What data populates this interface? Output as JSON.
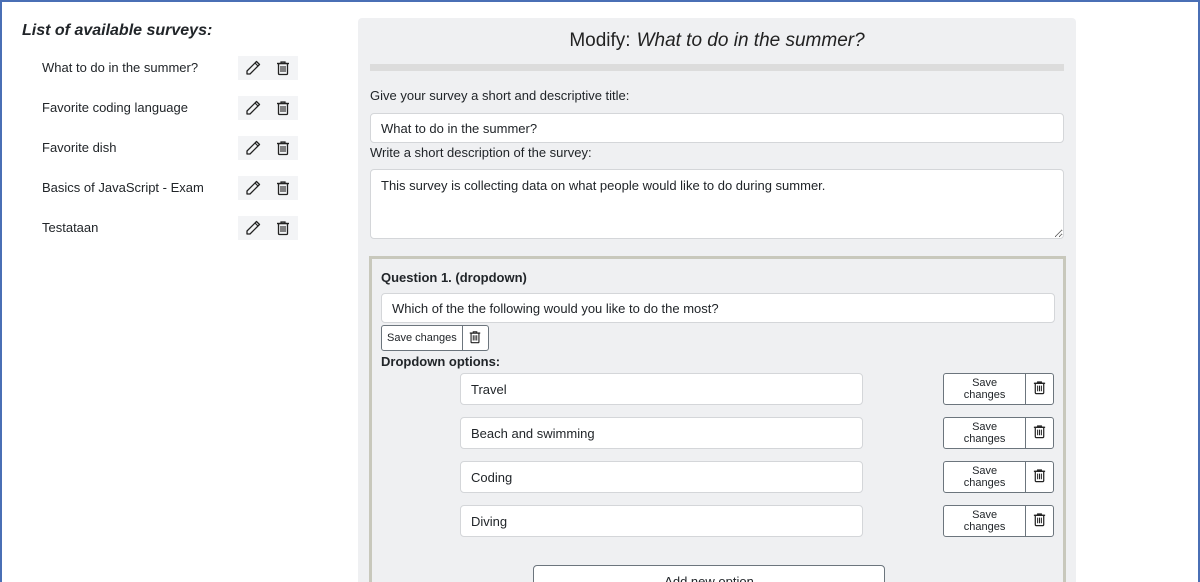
{
  "sidebar": {
    "title": "List of available surveys:",
    "surveys": [
      {
        "name": "What to do in the summer?"
      },
      {
        "name": "Favorite coding language"
      },
      {
        "name": "Favorite dish"
      },
      {
        "name": "Basics of JavaScript - Exam"
      },
      {
        "name": "Testataan"
      }
    ]
  },
  "editor": {
    "header_prefix": "Modify:",
    "header_title": "What to do in the summer?",
    "title_label": "Give your survey a short and descriptive title:",
    "title_value": "What to do in the summer?",
    "description_label": "Write a short description of the survey:",
    "description_value": "This survey is collecting data on what people would like to do during summer.",
    "question": {
      "heading": "Question 1. (dropdown)",
      "text": "Which of the the following would you like to do the most?",
      "save_label": "Save changes",
      "options_heading": "Dropdown options:",
      "options": [
        {
          "value": "Travel",
          "save_label": "Save changes"
        },
        {
          "value": "Beach and swimming",
          "save_label": "Save changes"
        },
        {
          "value": "Coding",
          "save_label": "Save changes"
        },
        {
          "value": "Diving",
          "save_label": "Save changes"
        }
      ],
      "add_option_label": "Add new option"
    }
  },
  "icons": {
    "edit": "pencil-icon",
    "delete": "trash-icon"
  }
}
